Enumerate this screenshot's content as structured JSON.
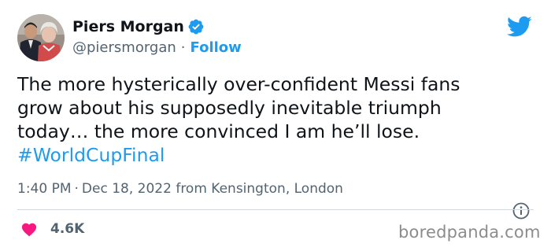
{
  "author": {
    "display_name": "Piers Morgan",
    "handle": "@piersmorgan",
    "separator": "·",
    "follow_label": "Follow",
    "verified": true
  },
  "tweet": {
    "lines": [
      "The more hysterically over-confident Messi fans",
      "grow about his supposedly inevitable triumph",
      "today… the more convinced I am he’ll lose."
    ],
    "hashtag": "#WorldCupFinal",
    "time": "1:40 PM",
    "date": "Dec 18, 2022",
    "location": "from Kensington, London",
    "separator": "·"
  },
  "engagement": {
    "likes": "4.6K"
  },
  "watermark": "boredpanda.com",
  "colors": {
    "accent": "#1d9bf0",
    "heart": "#f91880",
    "text": "#0f1419",
    "muted": "#536471"
  },
  "icons": [
    "avatar",
    "verified-badge-icon",
    "twitter-bird-icon",
    "info-icon",
    "heart-icon"
  ]
}
